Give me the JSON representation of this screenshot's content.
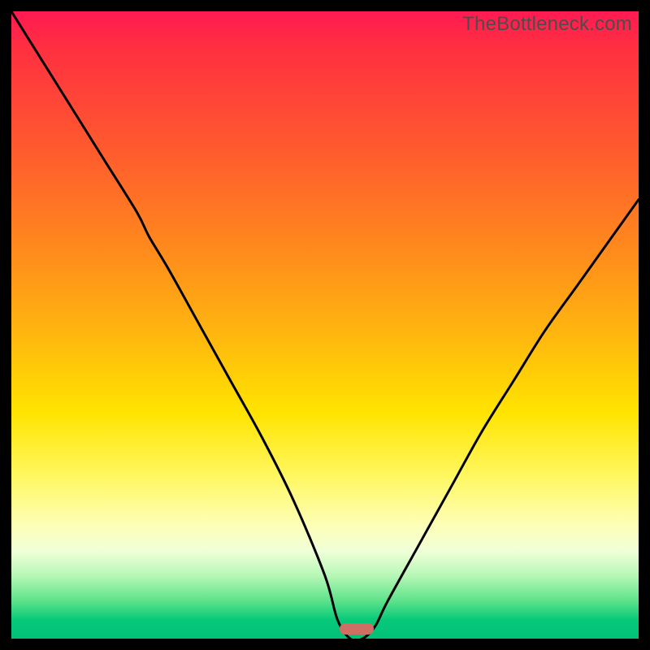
{
  "watermark": "TheBottleneck.com",
  "chart_data": {
    "type": "line",
    "title": "",
    "xlabel": "",
    "ylabel": "",
    "xlim": [
      0,
      100
    ],
    "ylim": [
      0,
      100
    ],
    "grid": false,
    "legend": false,
    "curve_description": "Bottleneck percentage vs. component balance. High at left, descends steeply to near-zero around x≈55, then rises again toward the right.",
    "x": [
      0,
      5,
      10,
      15,
      20,
      22,
      25,
      30,
      35,
      40,
      45,
      50,
      52,
      54,
      56,
      58,
      60,
      65,
      70,
      75,
      80,
      85,
      90,
      95,
      100
    ],
    "y": [
      100,
      92,
      84,
      76,
      68,
      64,
      59,
      50,
      41,
      32,
      22,
      10,
      3,
      0,
      0,
      2,
      6,
      15,
      24,
      33,
      41,
      49,
      56,
      63,
      70
    ],
    "optimal_x": 55,
    "optimal_y": 0,
    "gradient_meaning": "Background color encodes bottleneck severity: red (high) at top, green (none) at bottom."
  }
}
